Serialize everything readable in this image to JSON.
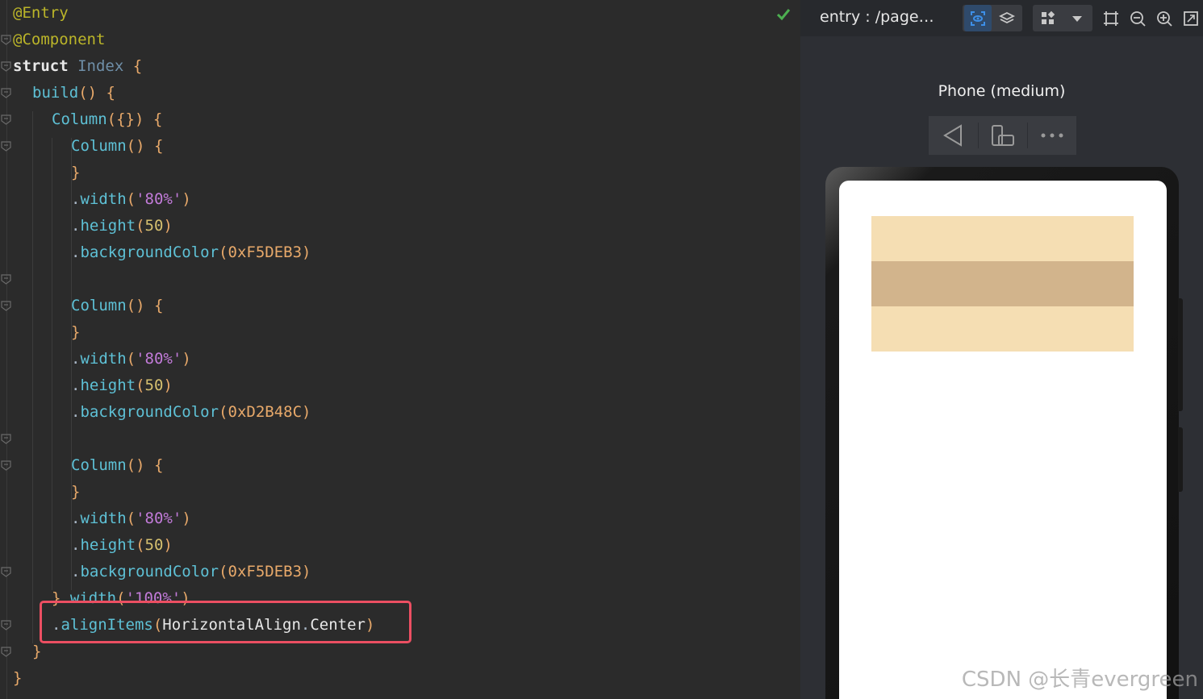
{
  "editor": {
    "lines": [
      {
        "indent": 0,
        "tokens": [
          [
            "dec",
            "@Entry"
          ]
        ]
      },
      {
        "indent": 0,
        "tokens": [
          [
            "dec",
            "@Component"
          ]
        ]
      },
      {
        "indent": 0,
        "tokens": [
          [
            "kw",
            "struct"
          ],
          [
            "dot",
            " "
          ],
          [
            "cls",
            "Index"
          ],
          [
            "dot",
            " "
          ],
          [
            "par",
            "{"
          ]
        ]
      },
      {
        "indent": 1,
        "tokens": [
          [
            "fn",
            "build"
          ],
          [
            "par",
            "()"
          ],
          [
            "dot",
            " "
          ],
          [
            "par",
            "{"
          ]
        ]
      },
      {
        "indent": 2,
        "tokens": [
          [
            "fn",
            "Column"
          ],
          [
            "par",
            "({})"
          ],
          [
            "dot",
            " "
          ],
          [
            "par",
            "{"
          ]
        ]
      },
      {
        "indent": 3,
        "tokens": [
          [
            "fn",
            "Column"
          ],
          [
            "par",
            "()"
          ],
          [
            "dot",
            " "
          ],
          [
            "par",
            "{"
          ]
        ]
      },
      {
        "indent": 3,
        "tokens": [
          [
            "par",
            "}"
          ]
        ]
      },
      {
        "indent": 3,
        "tokens": [
          [
            "dot",
            "."
          ],
          [
            "fn",
            "width"
          ],
          [
            "par",
            "("
          ],
          [
            "str",
            "'80%'"
          ],
          [
            "par",
            ")"
          ]
        ]
      },
      {
        "indent": 3,
        "tokens": [
          [
            "dot",
            "."
          ],
          [
            "fn",
            "height"
          ],
          [
            "par",
            "("
          ],
          [
            "num2",
            "50"
          ],
          [
            "par",
            ")"
          ]
        ]
      },
      {
        "indent": 3,
        "tokens": [
          [
            "dot",
            "."
          ],
          [
            "fn",
            "backgroundColor"
          ],
          [
            "par",
            "("
          ],
          [
            "hex",
            "0xF5DEB3"
          ],
          [
            "par",
            ")"
          ]
        ]
      },
      {
        "indent": 3,
        "tokens": []
      },
      {
        "indent": 3,
        "tokens": [
          [
            "fn",
            "Column"
          ],
          [
            "par",
            "()"
          ],
          [
            "dot",
            " "
          ],
          [
            "par",
            "{"
          ]
        ]
      },
      {
        "indent": 3,
        "tokens": [
          [
            "par",
            "}"
          ]
        ]
      },
      {
        "indent": 3,
        "tokens": [
          [
            "dot",
            "."
          ],
          [
            "fn",
            "width"
          ],
          [
            "par",
            "("
          ],
          [
            "str",
            "'80%'"
          ],
          [
            "par",
            ")"
          ]
        ]
      },
      {
        "indent": 3,
        "tokens": [
          [
            "dot",
            "."
          ],
          [
            "fn",
            "height"
          ],
          [
            "par",
            "("
          ],
          [
            "num2",
            "50"
          ],
          [
            "par",
            ")"
          ]
        ]
      },
      {
        "indent": 3,
        "tokens": [
          [
            "dot",
            "."
          ],
          [
            "fn",
            "backgroundColor"
          ],
          [
            "par",
            "("
          ],
          [
            "hex",
            "0xD2B48C"
          ],
          [
            "par",
            ")"
          ]
        ]
      },
      {
        "indent": 3,
        "tokens": []
      },
      {
        "indent": 3,
        "tokens": [
          [
            "fn",
            "Column"
          ],
          [
            "par",
            "()"
          ],
          [
            "dot",
            " "
          ],
          [
            "par",
            "{"
          ]
        ]
      },
      {
        "indent": 3,
        "tokens": [
          [
            "par",
            "}"
          ]
        ]
      },
      {
        "indent": 3,
        "tokens": [
          [
            "dot",
            "."
          ],
          [
            "fn",
            "width"
          ],
          [
            "par",
            "("
          ],
          [
            "str",
            "'80%'"
          ],
          [
            "par",
            ")"
          ]
        ]
      },
      {
        "indent": 3,
        "tokens": [
          [
            "dot",
            "."
          ],
          [
            "fn",
            "height"
          ],
          [
            "par",
            "("
          ],
          [
            "num2",
            "50"
          ],
          [
            "par",
            ")"
          ]
        ]
      },
      {
        "indent": 3,
        "tokens": [
          [
            "dot",
            "."
          ],
          [
            "fn",
            "backgroundColor"
          ],
          [
            "par",
            "("
          ],
          [
            "hex",
            "0xF5DEB3"
          ],
          [
            "par",
            ")"
          ]
        ]
      },
      {
        "indent": 2,
        "tokens": [
          [
            "par",
            "}"
          ],
          [
            "dot",
            "."
          ],
          [
            "fn",
            "width"
          ],
          [
            "par",
            "("
          ],
          [
            "str",
            "'100%'"
          ],
          [
            "par",
            ")"
          ]
        ]
      },
      {
        "indent": 2,
        "tokens": [
          [
            "dot",
            "."
          ],
          [
            "fn",
            "alignItems"
          ],
          [
            "par",
            "("
          ],
          [
            "id",
            "HorizontalAlign"
          ],
          [
            "dot",
            "."
          ],
          [
            "id",
            "Center"
          ],
          [
            "par",
            ")"
          ]
        ]
      },
      {
        "indent": 1,
        "tokens": [
          [
            "par",
            "}"
          ]
        ]
      },
      {
        "indent": 0,
        "tokens": [
          [
            "par",
            "}"
          ]
        ]
      }
    ],
    "fold_markers_on_lines": [
      2,
      3,
      4,
      5,
      6,
      11,
      12,
      17,
      18,
      22,
      24,
      25
    ]
  },
  "preview": {
    "title": "entry : /page…",
    "device_name": "Phone (medium)",
    "stripe_colors": [
      "#F5DEB3",
      "#D2B48C",
      "#F5DEB3"
    ]
  },
  "watermark": "CSDN @长青evergreen"
}
